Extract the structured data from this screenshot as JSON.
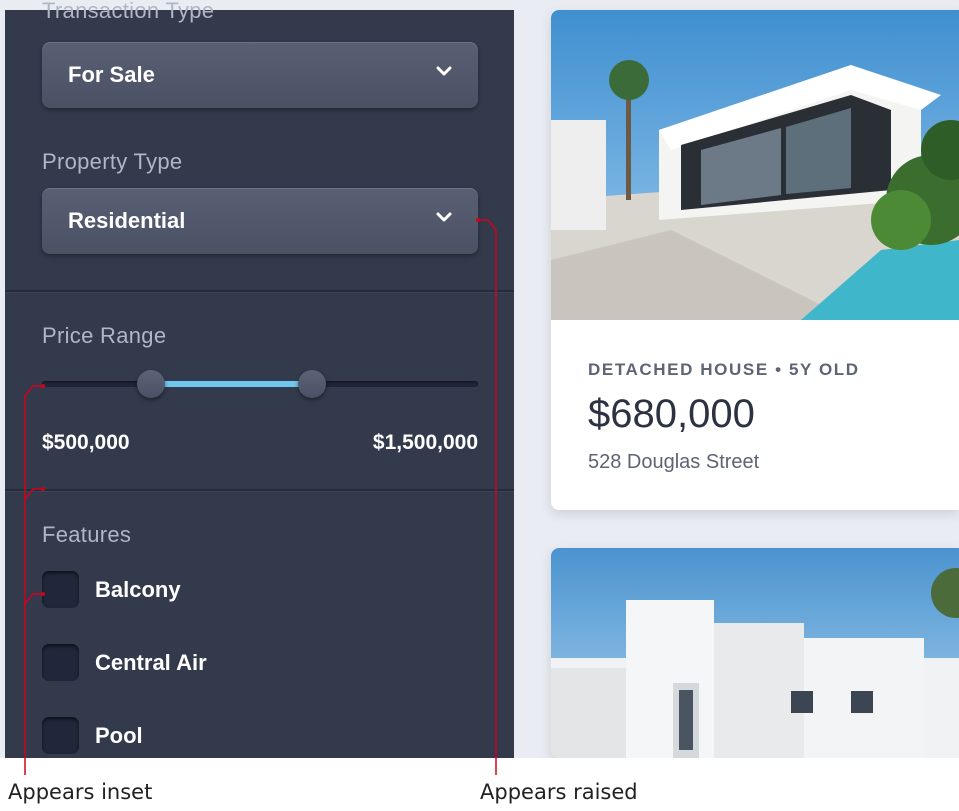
{
  "sidebar": {
    "transaction_type": {
      "label": "Transaction Type",
      "value": "For Sale"
    },
    "property_type": {
      "label": "Property Type",
      "value": "Residential"
    },
    "price_range": {
      "label": "Price Range",
      "min_label": "$500,000",
      "max_label": "$1,500,000",
      "range_start_fraction": 0.25,
      "range_end_fraction": 0.62
    },
    "features": {
      "label": "Features",
      "items": [
        {
          "label": "Balcony",
          "checked": false
        },
        {
          "label": "Central Air",
          "checked": false
        },
        {
          "label": "Pool",
          "checked": false
        }
      ]
    }
  },
  "listings": [
    {
      "meta": "DETACHED HOUSE • 5Y OLD",
      "price": "$680,000",
      "address": "528 Douglas Street"
    }
  ],
  "annotations": {
    "inset": "Appears inset",
    "raised": "Appears raised"
  },
  "colors": {
    "sidebar_bg": "#333a4c",
    "accent": "#71c6ef",
    "annotation_line": "#d0021b"
  },
  "icons": [
    "chevron-down-icon"
  ]
}
